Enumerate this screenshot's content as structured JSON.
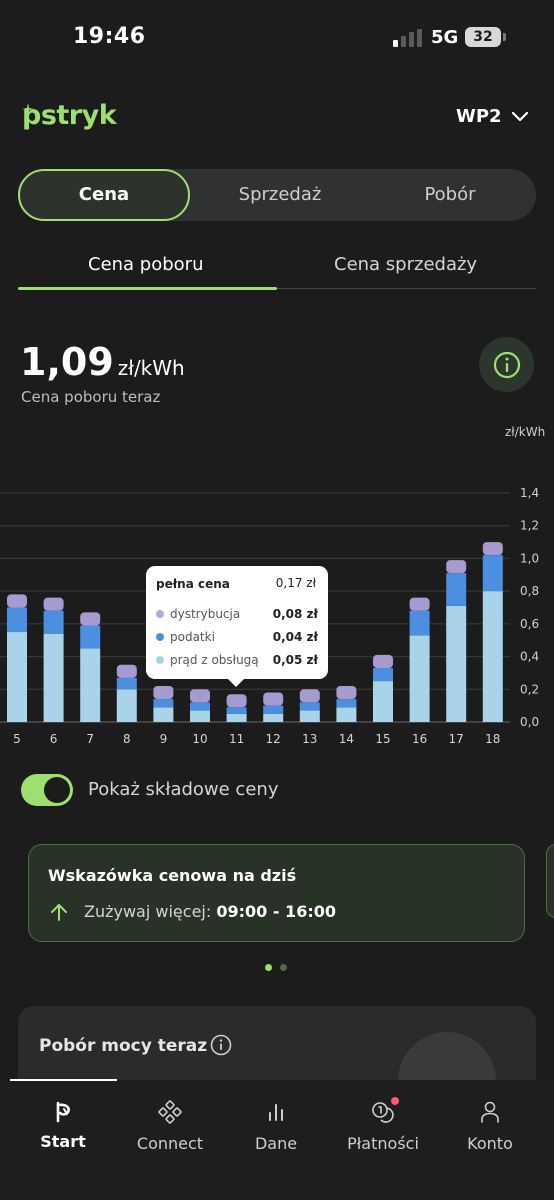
{
  "status_bar": {
    "time": "19:46",
    "network": "5G",
    "battery": "32"
  },
  "header": {
    "logo_text": "pstryk",
    "device_label": "WP2"
  },
  "segments": [
    {
      "label": "Cena",
      "active": true
    },
    {
      "label": "Sprzedaż",
      "active": false
    },
    {
      "label": "Pobór",
      "active": false
    }
  ],
  "tabs": [
    {
      "label": "Cena poboru",
      "active": true
    },
    {
      "label": "Cena sprzedaży",
      "active": false
    }
  ],
  "price": {
    "value": "1,09",
    "unit": "zł/kWh",
    "caption": "Cena poboru teraz"
  },
  "chart_unit": "zł/kWh",
  "chart_data": {
    "type": "bar",
    "stacked": true,
    "categories": [
      "5",
      "6",
      "7",
      "8",
      "9",
      "10",
      "11",
      "12",
      "13",
      "14",
      "15",
      "16",
      "17",
      "18"
    ],
    "series": [
      {
        "name": "prąd z obsługą",
        "color": "#a9d3e8",
        "values": [
          0.55,
          0.54,
          0.45,
          0.2,
          0.09,
          0.07,
          0.05,
          0.05,
          0.07,
          0.09,
          0.25,
          0.53,
          0.71,
          0.8
        ]
      },
      {
        "name": "podatki",
        "color": "#4b8fe0",
        "values": [
          0.15,
          0.14,
          0.14,
          0.07,
          0.05,
          0.05,
          0.04,
          0.05,
          0.05,
          0.05,
          0.08,
          0.15,
          0.2,
          0.22
        ]
      },
      {
        "name": "dystrybucja",
        "color": "#a79ad0",
        "values": [
          0.08,
          0.08,
          0.08,
          0.08,
          0.08,
          0.08,
          0.08,
          0.08,
          0.08,
          0.08,
          0.08,
          0.08,
          0.08,
          0.08
        ]
      }
    ],
    "ylim": [
      0,
      1.4
    ],
    "yticks": [
      "0,0",
      "0,2",
      "0,4",
      "0,6",
      "0,8",
      "1,0",
      "1,2",
      "1,4"
    ],
    "grid": true
  },
  "tooltip": {
    "title": "pełna cena",
    "total": "0,17 zł",
    "rows": [
      {
        "label": "dystrybucja",
        "value": "0,08 zł",
        "color": "#b2a8db"
      },
      {
        "label": "podatki",
        "value": "0,04 zł",
        "color": "#4b8fe0"
      },
      {
        "label": "prąd z obsługą",
        "value": "0,05 zł",
        "color": "#a9d3e8"
      }
    ]
  },
  "toggle": {
    "label": "Pokaż składowe ceny",
    "on": true
  },
  "hint": {
    "title": "Wskazówka cenowa na dziś",
    "text": "Zużywaj więcej:",
    "time": "09:00 - 16:00"
  },
  "power": {
    "title": "Pobór mocy teraz"
  },
  "nav": [
    {
      "label": "Start",
      "icon": "pstryk-logo-icon",
      "active": true
    },
    {
      "label": "Connect",
      "icon": "connect-icon",
      "active": false
    },
    {
      "label": "Dane",
      "icon": "bar-chart-icon",
      "active": false
    },
    {
      "label": "Płatności",
      "icon": "coins-icon",
      "active": false,
      "badge": true
    },
    {
      "label": "Konto",
      "icon": "person-icon",
      "active": false
    }
  ],
  "colors": {
    "accent": "#9ee06f",
    "background": "#1c1c1d",
    "badge": "#ff5a6e"
  }
}
